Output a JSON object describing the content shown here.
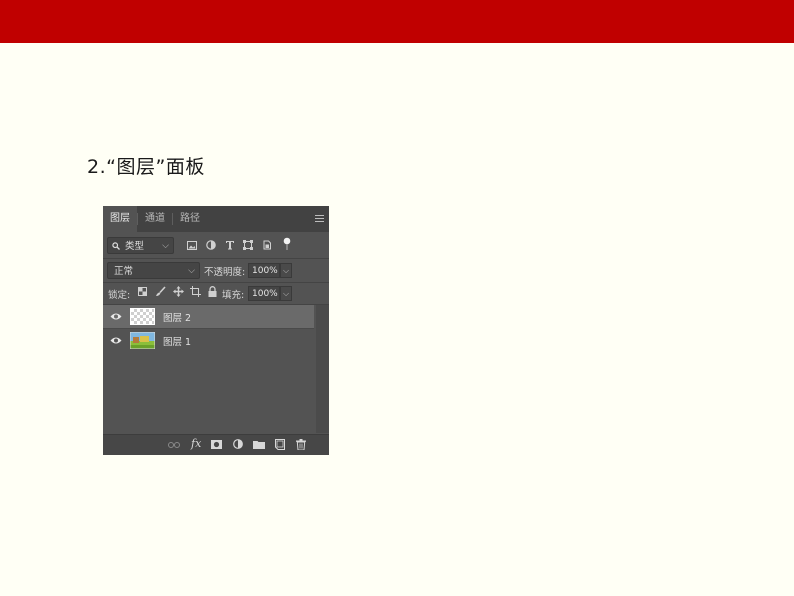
{
  "slide": {
    "heading": "2.“图层”面板"
  },
  "panel": {
    "tabs": [
      {
        "label": "图层",
        "active": true
      },
      {
        "label": "通道",
        "active": false
      },
      {
        "label": "路径",
        "active": false
      }
    ],
    "filter": {
      "label": "类型"
    },
    "filter_icons": [
      "image-filter-icon",
      "adjustment-filter-icon",
      "type-filter-icon",
      "shape-filter-icon",
      "smart-object-filter-icon",
      "filter-toggle-icon"
    ],
    "blend_mode": "正常",
    "opacity_label": "不透明度:",
    "opacity_value": "100%",
    "lock_label": "锁定:",
    "lock_icons": [
      "lock-transparent-icon",
      "lock-image-icon",
      "lock-position-icon",
      "lock-artboard-icon",
      "lock-all-icon"
    ],
    "fill_label": "填充:",
    "fill_value": "100%",
    "layers": [
      {
        "name": "图层 2",
        "visible": true,
        "selected": true,
        "thumb": "transparent"
      },
      {
        "name": "图层 1",
        "visible": true,
        "selected": false,
        "thumb": "image"
      }
    ],
    "bottom_icons": [
      "link-layers-icon",
      "fx-icon",
      "mask-icon",
      "adjustment-layer-icon",
      "group-folder-icon",
      "new-layer-icon",
      "trash-icon"
    ],
    "colors": {
      "panel_bg": "#535353",
      "tabbar_bg": "#424242",
      "selected_layer": "#6a6a6a",
      "slide_bar": "#c00000",
      "slide_bg": "#fffff5"
    }
  }
}
